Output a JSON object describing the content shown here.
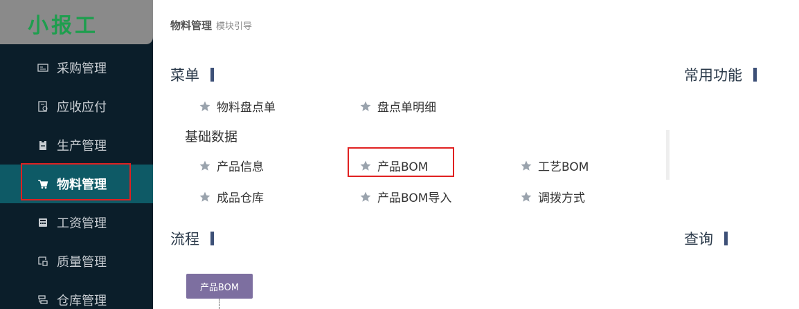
{
  "app": {
    "logo_text": "小报工"
  },
  "sidebar": {
    "items": [
      {
        "label": "采购管理",
        "icon": "receipt-icon"
      },
      {
        "label": "应收应付",
        "icon": "ledger-icon"
      },
      {
        "label": "生产管理",
        "icon": "clipboard-icon"
      },
      {
        "label": "物料管理",
        "icon": "cart-icon",
        "active": true
      },
      {
        "label": "工资管理",
        "icon": "calculator-icon"
      },
      {
        "label": "质量管理",
        "icon": "inspect-icon"
      },
      {
        "label": "仓库管理",
        "icon": "warehouse-icon"
      }
    ]
  },
  "breadcrumb": {
    "main": "物料管理",
    "sub": "模块引导"
  },
  "sections": {
    "menu_title": "菜单",
    "common_title": "常用功能",
    "flow_title": "流程",
    "query_title": "查询"
  },
  "menu": {
    "top_items": [
      "物料盘点单",
      "盘点单明细"
    ],
    "group_title": "基础数据",
    "group_items": [
      "产品信息",
      "产品BOM",
      "工艺BOM",
      "成品仓库",
      "产品BOM导入",
      "调拨方式"
    ]
  },
  "flow": {
    "node_label": "产品BOM"
  },
  "colors": {
    "sidebar_bg": "#0b1e2a",
    "active_bg": "#0e5a66",
    "logo_green": "#1e9e4e",
    "highlight_red": "#e02020",
    "section_bar": "#3d5077",
    "flow_node": "#7d6fa0",
    "star": "#9aa3ad"
  }
}
